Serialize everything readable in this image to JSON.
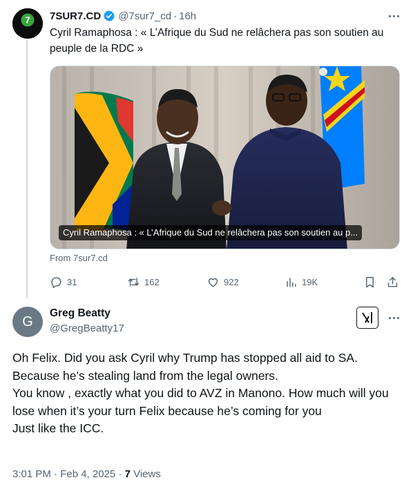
{
  "parent_tweet": {
    "author_name": "7SUR7.CD",
    "handle": "@7sur7_cd",
    "separator": "·",
    "time": "16h",
    "avatar_text": "7SUR7.CD",
    "text": "Cyril Ramaphosa : « L’Afrique du Sud ne relâchera pas son soutien au peuple de la RDC »",
    "card": {
      "caption": "Cyril Ramaphosa : « L’Afrique du Sud ne relâchera pas son soutien au p...",
      "source": "From 7sur7.cd"
    },
    "actions": {
      "replies": "31",
      "reposts": "162",
      "likes": "922",
      "views": "19K"
    }
  },
  "main_tweet": {
    "author_name": "Greg Beatty",
    "handle": "@GregBeatty17",
    "avatar_letter": "G",
    "lines": [
      "Oh Felix. Did you ask Cyril why Trump has stopped all aid to SA.",
      "Because he’s stealing land from the legal owners.",
      "You know , exactly what you did to AVZ in Manono. How much will you lose when it’s your turn Felix because he’s coming for you",
      "Just like the ICC."
    ],
    "timestamp": "3:01 PM · Feb 4, 2025 · ",
    "views_count": "7",
    "views_label": " Views"
  },
  "colors": {
    "verified_blue": "#1d9bf0",
    "muted_text": "#536471",
    "avatar_grey": "#6a7985",
    "flag_green": "#007a4d",
    "flag_blue_drc": "#007fff"
  },
  "icons": [
    "verified-badge-icon",
    "more-icon",
    "reply-icon",
    "repost-icon",
    "like-icon",
    "views-icon",
    "bookmark-icon",
    "share-icon",
    "grok-icon"
  ]
}
